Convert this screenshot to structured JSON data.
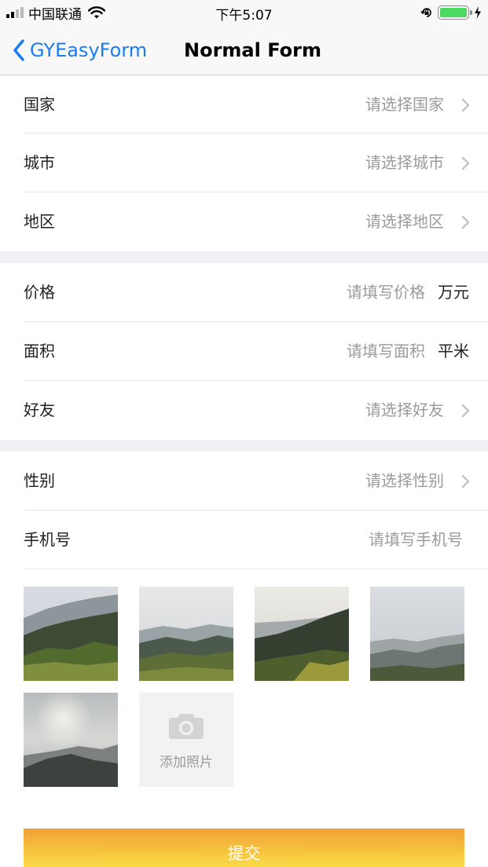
{
  "status_bar": {
    "carrier": "中国联通",
    "time": "下午5:07"
  },
  "nav": {
    "back_label": "GYEasyForm",
    "title": "Normal Form"
  },
  "section1": [
    {
      "label": "国家",
      "placeholder": "请选择国家"
    },
    {
      "label": "城市",
      "placeholder": "请选择城市"
    },
    {
      "label": "地区",
      "placeholder": "请选择地区"
    }
  ],
  "section2": [
    {
      "label": "价格",
      "placeholder": "请填写价格",
      "unit": "万元"
    },
    {
      "label": "面积",
      "placeholder": "请填写面积",
      "unit": "平米"
    },
    {
      "label": "好友",
      "placeholder": "请选择好友"
    }
  ],
  "section3": [
    {
      "label": "性别",
      "placeholder": "请选择性别"
    },
    {
      "label": "手机号",
      "placeholder": "请填写手机号"
    }
  ],
  "photos": {
    "add_label": "添加照片"
  },
  "submit_label": "提交",
  "colors": {
    "accent": "#1a7cf2",
    "battery": "#4cd964",
    "separator": "#efeff4",
    "button_top": "#f0a13a",
    "button_bottom": "#fbe24a"
  }
}
